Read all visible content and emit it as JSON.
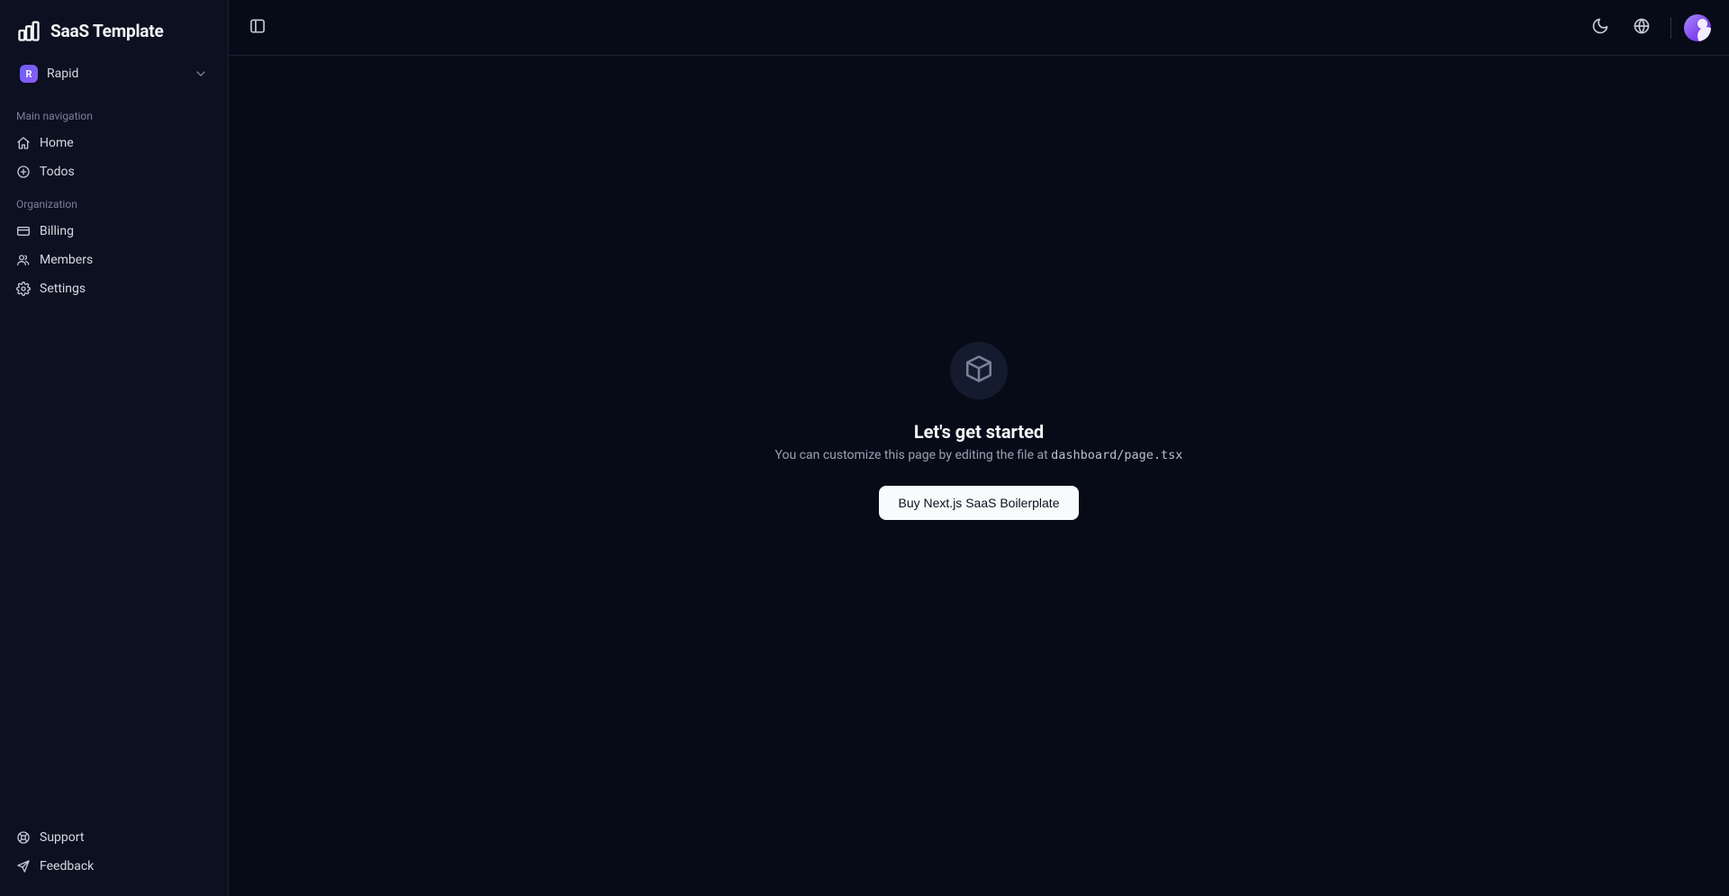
{
  "brand": {
    "name": "SaaS Template"
  },
  "org": {
    "initial": "R",
    "name": "Rapid"
  },
  "sections": {
    "main_label": "Main navigation",
    "org_label": "Organization"
  },
  "nav": {
    "main": [
      {
        "label": "Home"
      },
      {
        "label": "Todos"
      }
    ],
    "org": [
      {
        "label": "Billing"
      },
      {
        "label": "Members"
      },
      {
        "label": "Settings"
      }
    ],
    "bottom": [
      {
        "label": "Support"
      },
      {
        "label": "Feedback"
      }
    ]
  },
  "empty": {
    "title": "Let's get started",
    "subtitle_prefix": "You can customize this page by editing the file at ",
    "subtitle_code": "dashboard/page.tsx",
    "cta": "Buy Next.js SaaS Boilerplate"
  }
}
